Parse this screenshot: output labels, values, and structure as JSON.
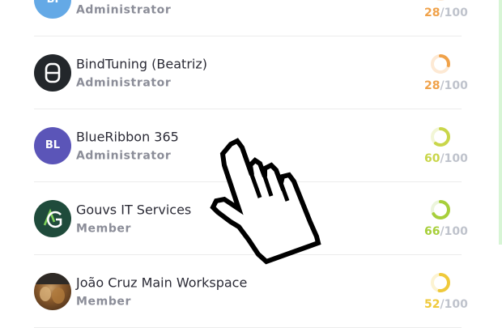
{
  "rows": [
    {
      "name": "",
      "role": "Administrator",
      "initials": "BI",
      "avatar_color": "#64a9e6",
      "score": "28",
      "denominator": "/100",
      "score_color": "#f0a24a",
      "ring_progress": 0.28
    },
    {
      "name": "BindTuning (Beatriz)",
      "role": "Administrator",
      "initials": "",
      "avatar_color": "#23272b",
      "score": "28",
      "denominator": "/100",
      "score_color": "#f0a24a",
      "ring_progress": 0.28
    },
    {
      "name": "BlueRibbon 365",
      "role": "Administrator",
      "initials": "BL",
      "avatar_color": "#5b55b8",
      "score": "60",
      "denominator": "/100",
      "score_color": "#c9d64a",
      "ring_progress": 0.6
    },
    {
      "name": "Gouvs IT Services",
      "role": "Member",
      "initials": "",
      "avatar_color": "#1f4b3b",
      "score": "66",
      "denominator": "/100",
      "score_color": "#a7cf3a",
      "ring_progress": 0.66
    },
    {
      "name": "João Cruz Main Workspace",
      "role": "Member",
      "initials": "",
      "avatar_color": "#6b4a2a",
      "score": "52",
      "denominator": "/100",
      "score_color": "#efc93a",
      "ring_progress": 0.52
    }
  ]
}
